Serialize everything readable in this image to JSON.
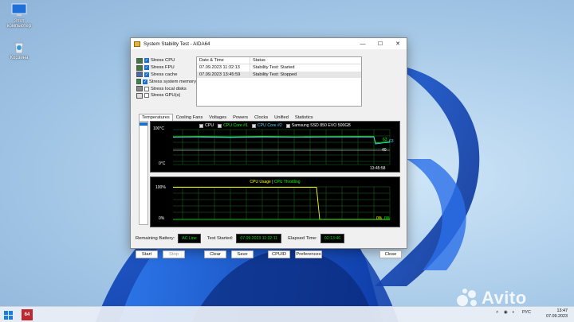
{
  "desktop": {
    "icons": [
      {
        "label": "Этот компьютер",
        "icon": "computer-icon"
      },
      {
        "label": "Корзина",
        "icon": "recycle-bin-icon"
      }
    ]
  },
  "window": {
    "title": "System Stability Test - AIDA64",
    "minimize": "—",
    "maximize": "☐",
    "close": "✕"
  },
  "stress_options": [
    {
      "label": "Stress CPU",
      "checked": true
    },
    {
      "label": "Stress FPU",
      "checked": true
    },
    {
      "label": "Stress cache",
      "checked": true
    },
    {
      "label": "Stress system memory",
      "checked": true
    },
    {
      "label": "Stress local disks",
      "checked": false
    },
    {
      "label": "Stress GPU(s)",
      "checked": false
    }
  ],
  "log": {
    "headers": [
      "Date & Time",
      "Status"
    ],
    "rows": [
      [
        "07.09.2023 11:32:13",
        "Stability Test: Started"
      ],
      [
        "07.09.2023 13:45:59",
        "Stability Test: Stopped"
      ]
    ]
  },
  "tabs": [
    "Temperatures",
    "Cooling Fans",
    "Voltages",
    "Powers",
    "Clocks",
    "Unified",
    "Statistics"
  ],
  "temp_graph": {
    "legend": [
      {
        "label": "CPU",
        "color": "#ffffff"
      },
      {
        "label": "CPU Core #1",
        "color": "#00ff00"
      },
      {
        "label": "CPU Core #2",
        "color": "#48d8ff"
      },
      {
        "label": "Samsung SSD 850 EVO 500GB",
        "color": "#ffffff"
      }
    ],
    "y_top": "100°C",
    "y_bottom": "0°C",
    "end_labels": [
      "63",
      "63",
      "40"
    ],
    "time_label": "13:45:58"
  },
  "usage_graph": {
    "title": "CPU Usage",
    "separator": "|",
    "title2": "CPU Throttling",
    "y_top": "100%",
    "y_bottom": "0%",
    "end_labels": [
      "0%",
      "0%"
    ],
    "title_color": "#ffff00",
    "title2_color": "#00ff00"
  },
  "status": {
    "battery_label": "Remaining Battery:",
    "battery_value": "AC Line",
    "started_label": "Test Started:",
    "started_value": "07.09.2023 11:32:11",
    "elapsed_label": "Elapsed Time:",
    "elapsed_value": "02:13:46"
  },
  "buttons": {
    "start": "Start",
    "stop": "Stop",
    "clear": "Clear",
    "save": "Save",
    "cpuid": "CPUID",
    "preferences": "Preferences",
    "close": "Close"
  },
  "taskbar": {
    "app_badge": "64",
    "lang": "РУС",
    "time": "13:47",
    "date": "07.09.2023",
    "tray_icons": [
      "chevron-up-icon",
      "wifi-icon",
      "volume-icon"
    ]
  },
  "watermark": "Avito"
}
